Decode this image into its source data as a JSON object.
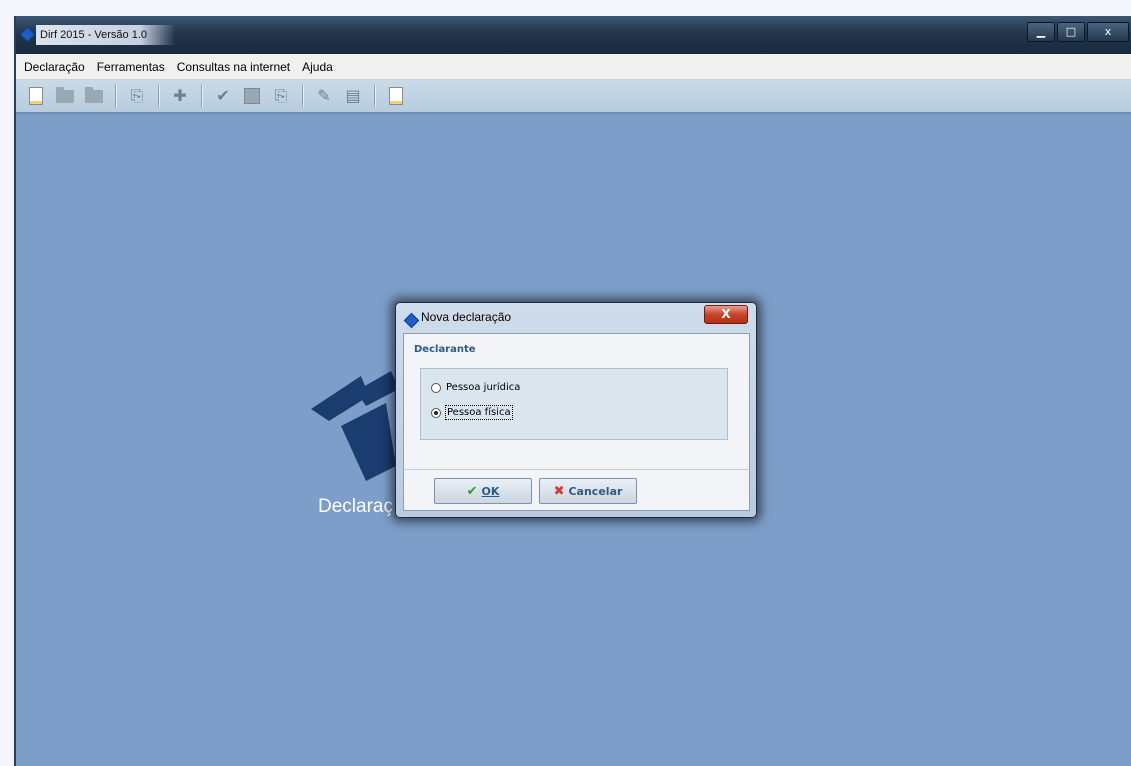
{
  "window": {
    "title": "Dirf 2015 - Versão 1.0",
    "controls": {
      "minimize": "▁",
      "maximize": "□",
      "close": "x"
    }
  },
  "menubar": {
    "items": [
      "Declaração",
      "Ferramentas",
      "Consultas na internet",
      "Ajuda"
    ]
  },
  "toolbar": {
    "icons": [
      "new-document",
      "open-folder",
      "folder",
      "copy-declaration",
      "import",
      "verify-check",
      "stop",
      "transmit",
      "tools",
      "calculator",
      "report"
    ]
  },
  "background": {
    "text": "Declaraç"
  },
  "dialog": {
    "title": "Nova declaração",
    "close_label": "X",
    "group_label": "Declarante",
    "options": [
      {
        "label": "Pessoa jurídica",
        "selected": false
      },
      {
        "label": "Pessoa física",
        "selected": true
      }
    ],
    "ok_button": "OK",
    "cancel_button": "Cancelar"
  },
  "colors": {
    "desktop": "#7c9ec8",
    "accent": "#2e5a86",
    "brand_blue": "#1b3c6e"
  }
}
